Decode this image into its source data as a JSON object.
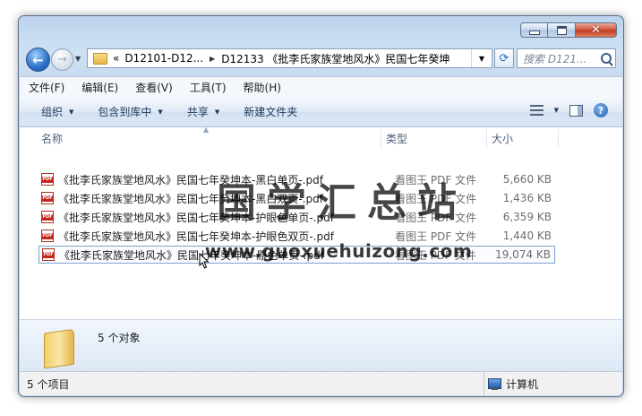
{
  "window": {
    "caption_buttons": {
      "minimize": "minimize-icon",
      "maximize": "maximize-icon",
      "close": "close-icon"
    }
  },
  "nav": {
    "crumb_prefix": "«",
    "crumbs": [
      "D12101-D12...",
      "D12133 《批李氏家族堂地风水》民国七年癸坤"
    ],
    "search_placeholder": "搜索 D121..."
  },
  "menu": [
    "文件(F)",
    "编辑(E)",
    "查看(V)",
    "工具(T)",
    "帮助(H)"
  ],
  "toolbar": {
    "organize": "组织",
    "include": "包含到库中",
    "share": "共享",
    "new_folder": "新建文件夹"
  },
  "columns": {
    "name": "名称",
    "type": "类型",
    "size": "大小"
  },
  "files": [
    {
      "name": "《批李氏家族堂地风水》民国七年癸坤本-黑白单页-.pdf",
      "type": "看图王 PDF 文件",
      "size": "5,660 KB"
    },
    {
      "name": "《批李氏家族堂地风水》民国七年癸坤本-黑白双页-.pdf",
      "type": "看图王 PDF 文件",
      "size": "1,436 KB"
    },
    {
      "name": "《批李氏家族堂地风水》民国七年癸坤本-护眼色单页-.pdf",
      "type": "看图王 PDF 文件",
      "size": "6,359 KB"
    },
    {
      "name": "《批李氏家族堂地风水》民国七年癸坤本-护眼色双页-.pdf",
      "type": "看图王 PDF 文件",
      "size": "1,440 KB"
    },
    {
      "name": "《批李氏家族堂地风水》民国七年癸坤本-原色单页-.pdf",
      "type": "看图王 PDF 文件",
      "size": "19,074 KB"
    }
  ],
  "selected_index": 4,
  "watermark": {
    "text": "国学汇总站",
    "url": "www.guoxuehuizong.com"
  },
  "details": {
    "count": "5 个对象"
  },
  "status": {
    "items": "5 个项目",
    "location": "计算机"
  }
}
